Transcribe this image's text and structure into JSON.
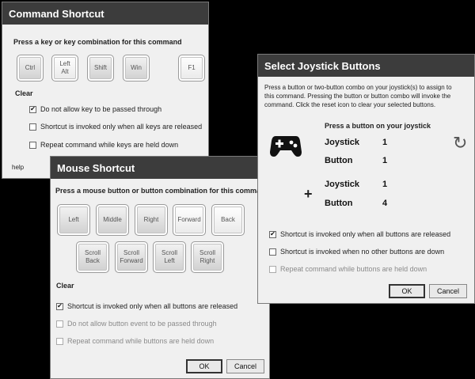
{
  "command_dialog": {
    "title": "Command Shortcut",
    "prompt": "Press a key or key combination for this command",
    "keys": {
      "ctrl": "Ctrl",
      "left_alt_line1": "Left",
      "left_alt_line2": "Alt",
      "shift": "Shift",
      "win": "Win",
      "f1": "F1"
    },
    "clear": "Clear",
    "opt1": "Do not allow key to be passed through",
    "opt2": "Shortcut is invoked only when all keys are released",
    "opt3": "Repeat command while keys are held down",
    "help": "help",
    "checked": [
      true,
      false,
      false
    ]
  },
  "mouse_dialog": {
    "title": "Mouse Shortcut",
    "prompt": "Press a mouse button or button combination for this command",
    "buttons": {
      "left": "Left",
      "middle": "Middle",
      "right": "Right",
      "forward": "Forward",
      "back": "Back",
      "scroll_back_1": "Scroll",
      "scroll_back_2": "Back",
      "scroll_fwd_1": "Scroll",
      "scroll_fwd_2": "Forward",
      "scroll_left_1": "Scroll",
      "scroll_left_2": "Left",
      "scroll_right_1": "Scroll",
      "scroll_right_2": "Right"
    },
    "clear": "Clear",
    "opt1": "Shortcut is invoked only when all buttons are released",
    "opt2": "Do not allow button event to be passed through",
    "opt3": "Repeat command while buttons are held down",
    "ok": "OK",
    "cancel": "Cancel"
  },
  "joystick_dialog": {
    "title": "Select Joystick Buttons",
    "desc_line1": "Press a button or two-button combo on your joystick(s) to assign to",
    "desc_line2": "this command.  Pressing the button or button combo will invoke the",
    "desc_line3": "command.  Click the reset icon to clear your selected buttons.",
    "press_prompt": "Press a button on your joystick",
    "joystick_label": "Joystick",
    "button_label": "Button",
    "first": {
      "joystick": "1",
      "button": "1"
    },
    "second": {
      "joystick": "1",
      "button": "4"
    },
    "plus": "+",
    "reset_glyph": "↻",
    "opt1": "Shortcut is invoked only when all buttons are released",
    "opt2": "Shortcut is invoked when no other buttons are down",
    "opt3": "Repeat command while buttons are held down",
    "ok": "OK",
    "cancel": "Cancel"
  },
  "checkmark": "✔"
}
